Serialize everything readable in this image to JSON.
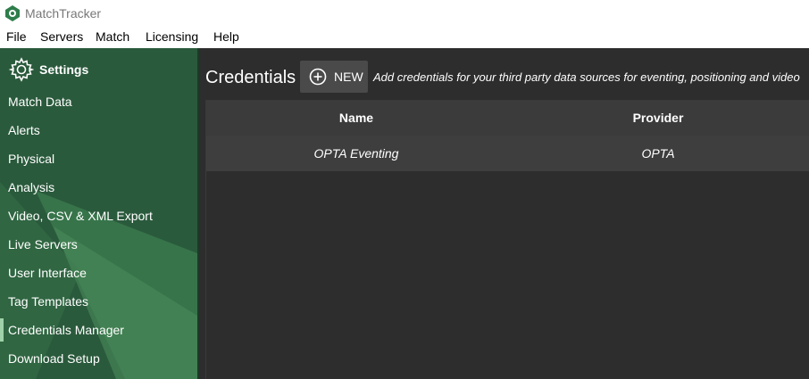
{
  "app": {
    "title": "MatchTracker"
  },
  "menu": [
    "File",
    "Servers",
    "Match",
    "Licensing",
    "Help"
  ],
  "sidebar": {
    "header": "Settings",
    "items": [
      {
        "label": "Match Data"
      },
      {
        "label": "Alerts"
      },
      {
        "label": "Physical"
      },
      {
        "label": "Analysis"
      },
      {
        "label": "Video, CSV & XML Export"
      },
      {
        "label": "Live Servers"
      },
      {
        "label": "User Interface"
      },
      {
        "label": "Tag Templates"
      },
      {
        "label": "Credentials Manager",
        "active": true
      },
      {
        "label": "Download Setup"
      }
    ]
  },
  "main": {
    "title": "Credentials",
    "new_button": "NEW",
    "description": "Add credentials for your third party data sources for eventing, positioning and video",
    "table": {
      "columns": [
        "Name",
        "Provider"
      ],
      "rows": [
        [
          "OPTA Eventing",
          "OPTA"
        ]
      ]
    }
  },
  "colors": {
    "sidebar": "#2a5a3c",
    "main_bg": "#2d2d2d",
    "active_indicator": "#9fd2a9"
  }
}
